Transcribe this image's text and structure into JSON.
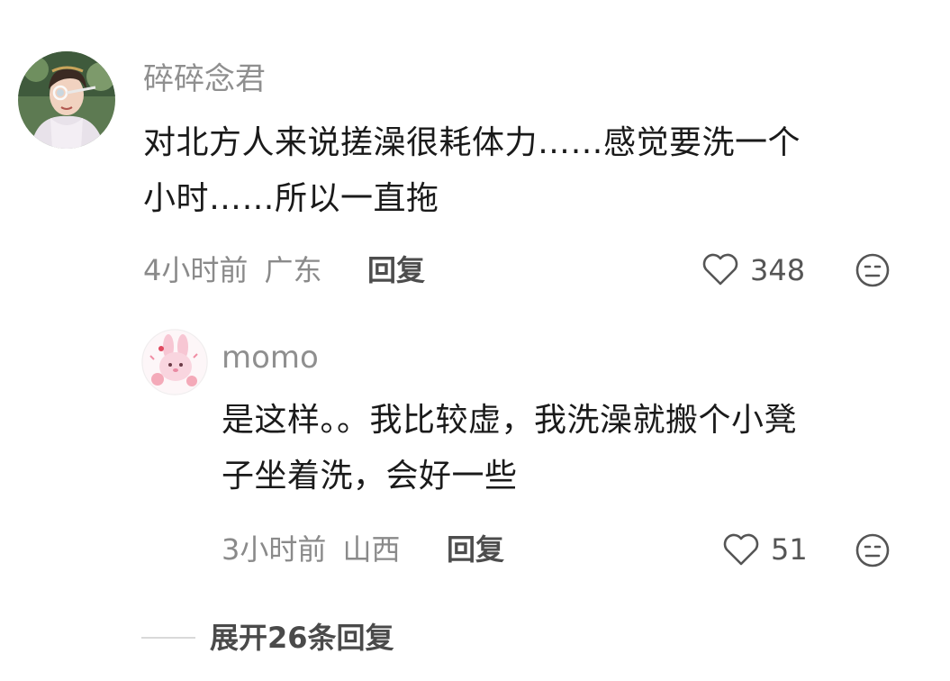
{
  "comment": {
    "avatar": "woman-avatar",
    "username": "碎碎念君",
    "text_line1": "对北方人来说搓澡很耗体力……感觉要洗一个",
    "text_line2": "小时……所以一直拖",
    "time": "4小时前",
    "location": "广东",
    "reply_label": "回复",
    "likes": "348",
    "like_icon": "heart-outline-icon",
    "reaction_icon": "neutral-face-icon"
  },
  "reply": {
    "avatar": "pink-bunny-avatar",
    "username": "momo",
    "text_line1": "是这样。。我比较虚，我洗澡就搬个小凳",
    "text_line2": "子坐着洗，会好一些",
    "time": "3小时前",
    "location": "山西",
    "reply_label": "回复",
    "likes": "51",
    "like_icon": "heart-outline-icon",
    "reaction_icon": "neutral-face-icon"
  },
  "expand": {
    "label": "展开26条回复"
  }
}
